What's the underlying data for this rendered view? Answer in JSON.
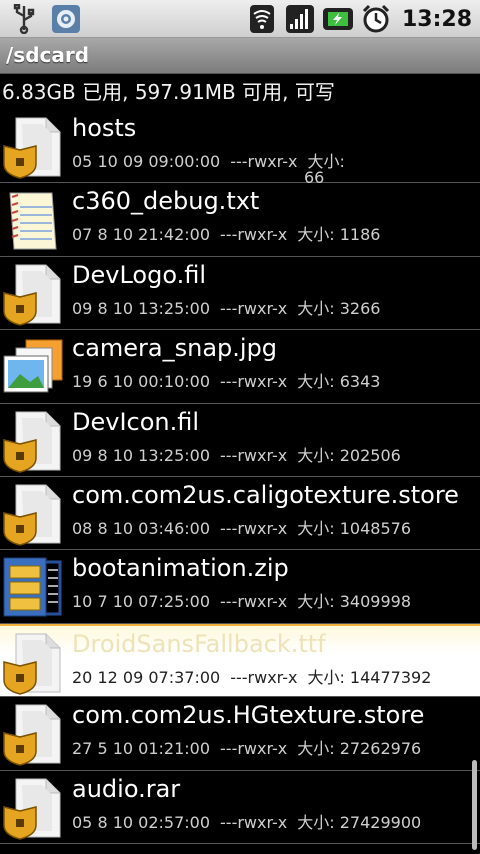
{
  "statusbar": {
    "left_icons": [
      "usb-icon",
      "settings-notification-icon"
    ],
    "right_icons": [
      "wifi-icon",
      "signal-icon",
      "battery-charging-icon",
      "alarm-clock-icon"
    ],
    "time": "13:28"
  },
  "title": "/sdcard",
  "storage_info": "6.83GB 已用, 597.91MB 可用, 可写",
  "files": [
    {
      "name": "hosts",
      "date": "05 10 09 09:00:00",
      "perm": "---rwxr-x",
      "size": "大小:",
      "size2": "66",
      "icon": "locked-file-icon"
    },
    {
      "name": "c360_debug.txt",
      "date": "07 8 10 21:42:00",
      "perm": "---rwxr-x",
      "size": "大小: 1186",
      "icon": "text-file-icon"
    },
    {
      "name": "DevLogo.fil",
      "date": "09 8 10 13:25:00",
      "perm": "---rwxr-x",
      "size": "大小: 3266",
      "icon": "locked-file-icon"
    },
    {
      "name": "camera_snap.jpg",
      "date": "19 6 10 00:10:00",
      "perm": "---rwxr-x",
      "size": "大小: 6343",
      "icon": "image-file-icon"
    },
    {
      "name": "DevIcon.fil",
      "date": "09 8 10 13:25:00",
      "perm": "---rwxr-x",
      "size": "大小: 202506",
      "icon": "locked-file-icon"
    },
    {
      "name": "com.com2us.caligotexture.store",
      "date": "08 8 10 03:46:00",
      "perm": "---rwxr-x",
      "size": "大小: 1048576",
      "icon": "locked-file-icon"
    },
    {
      "name": "bootanimation.zip",
      "date": "10 7 10 07:25:00",
      "perm": "---rwxr-x",
      "size": "大小: 3409998",
      "icon": "zip-archive-icon"
    },
    {
      "name": "DroidSansFallback.ttf",
      "date": "20 12 09 07:37:00",
      "perm": "---rwxr-x",
      "size": "大小: 14477392",
      "icon": "locked-file-icon",
      "selected": true
    },
    {
      "name": "com.com2us.HGtexture.store",
      "date": "27 5 10 01:21:00",
      "perm": "---rwxr-x",
      "size": "大小: 27262976",
      "icon": "locked-file-icon"
    },
    {
      "name": "audio.rar",
      "date": "05 8 10 02:57:00",
      "perm": "---rwxr-x",
      "size": "大小: 27429900",
      "icon": "locked-file-icon"
    }
  ]
}
